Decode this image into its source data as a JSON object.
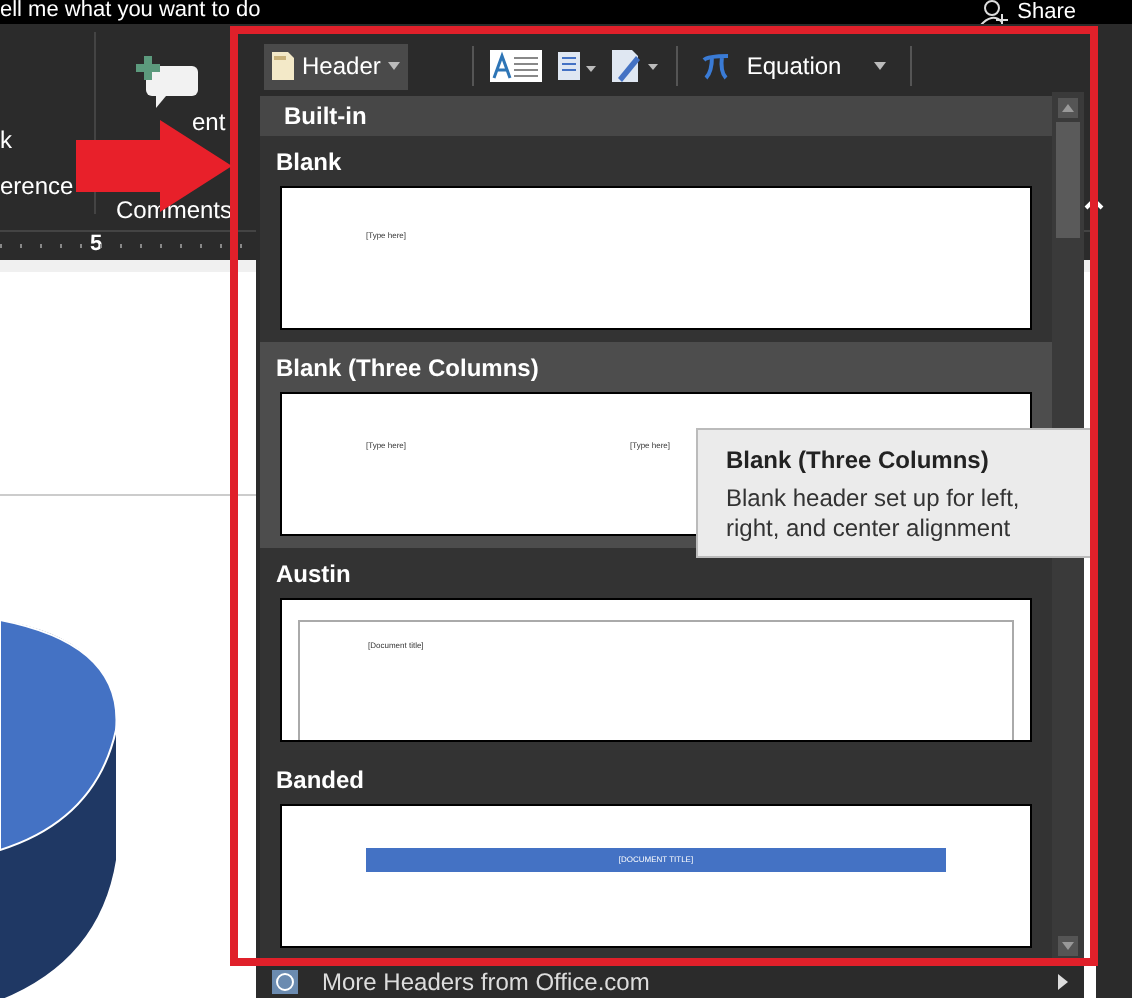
{
  "top_bar": {
    "search_hint": "ell me what you want to do",
    "share": "Share"
  },
  "ribbon": {
    "labels": [
      "k",
      "erence"
    ],
    "comment_button": "ent",
    "group_label": "Comments"
  },
  "ruler": {
    "mark": "5"
  },
  "header_menu": {
    "header_button": {
      "label": "Header",
      "expanded": true
    },
    "equation_button": {
      "label": "Equation"
    },
    "category": "Built-in",
    "items": [
      {
        "name": "Blank",
        "kind": "blank",
        "selected": false,
        "texts": [
          "[Type here]"
        ]
      },
      {
        "name": "Blank (Three Columns)",
        "kind": "three",
        "selected": true,
        "texts": [
          "[Type here]",
          "[Type here]"
        ]
      },
      {
        "name": "Austin",
        "kind": "austin",
        "selected": false,
        "texts": [
          "[Document title]"
        ]
      },
      {
        "name": "Banded",
        "kind": "banded",
        "selected": false,
        "texts": [
          "[DOCUMENT TITLE]"
        ]
      }
    ],
    "footer": "More Headers from Office.com"
  },
  "tooltip": {
    "title": "Blank (Three Columns)",
    "description": "Blank header set up for left, right, and center alignment"
  }
}
